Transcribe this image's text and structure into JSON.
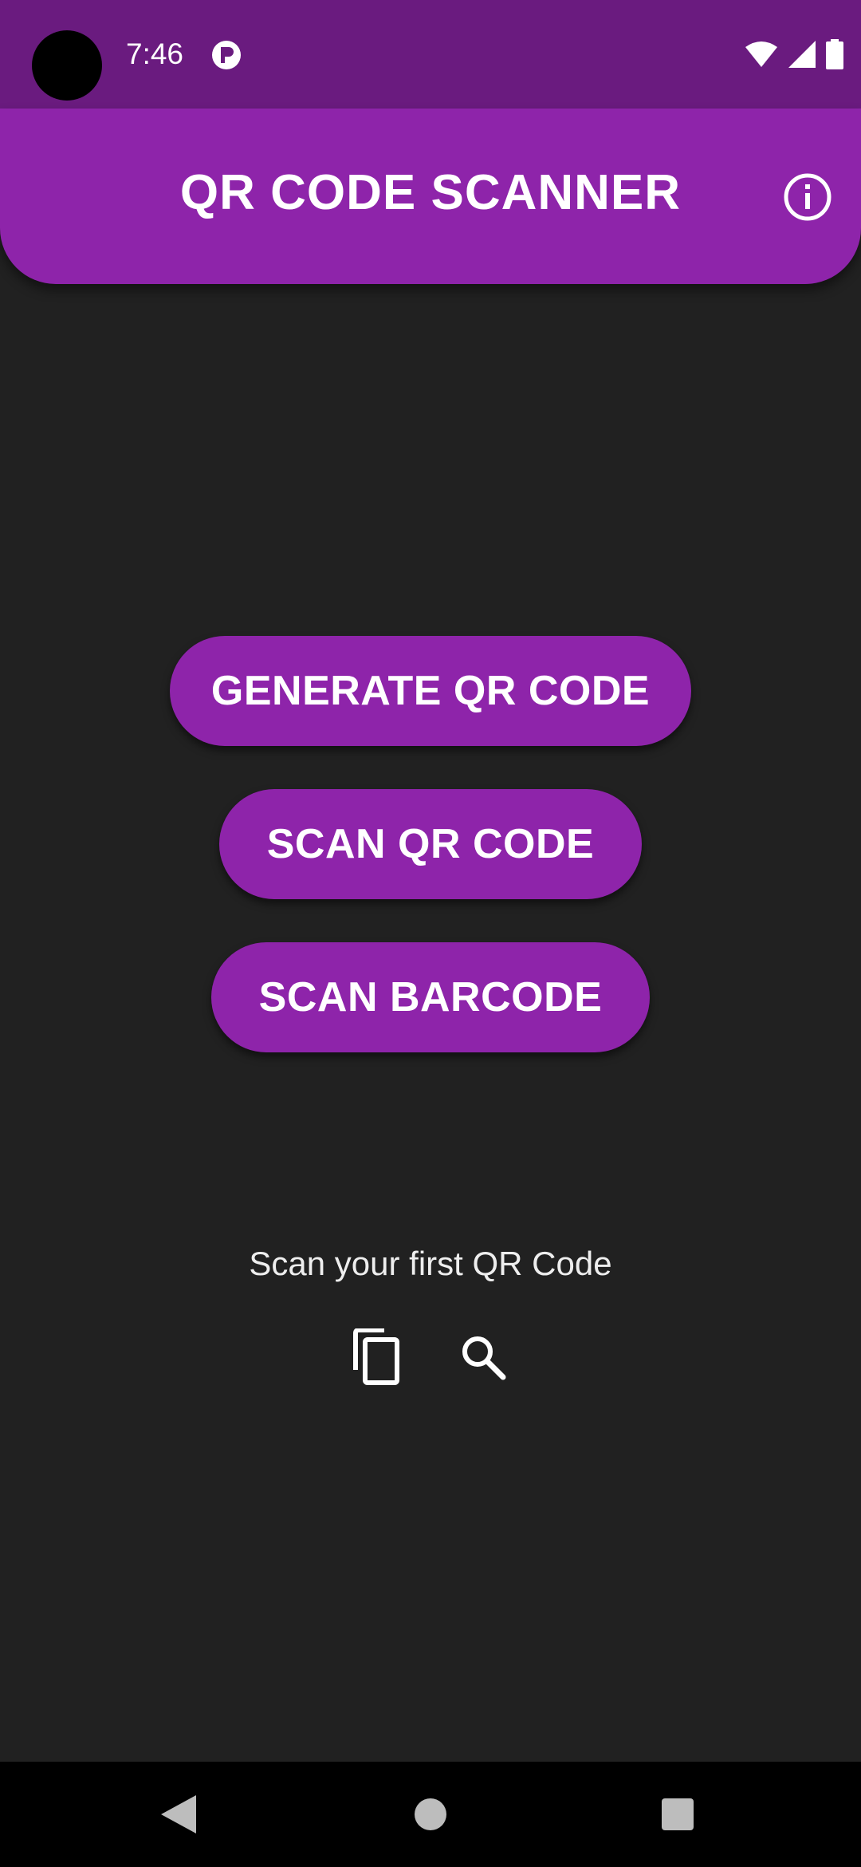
{
  "status_bar": {
    "time": "7:46",
    "icons": [
      "notification-app-icon",
      "wifi-icon",
      "cellular-signal-icon",
      "battery-icon"
    ]
  },
  "app_bar": {
    "title": "QR CODE SCANNER",
    "info_icon": "info-icon"
  },
  "main": {
    "buttons": [
      {
        "label": "GENERATE QR CODE"
      },
      {
        "label": "SCAN QR CODE"
      },
      {
        "label": "SCAN BARCODE"
      }
    ],
    "hint": "Scan your first QR Code",
    "action_icons": [
      "copy-icon",
      "search-icon"
    ]
  },
  "nav_bar": {
    "icons": [
      "back-icon",
      "home-icon",
      "recents-icon"
    ]
  },
  "colors": {
    "primary": "#8E24AA",
    "status_bar": "#6A1B7F",
    "background": "#212121"
  }
}
